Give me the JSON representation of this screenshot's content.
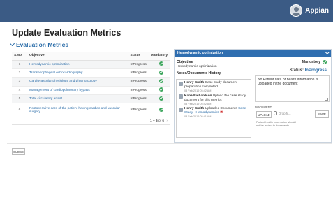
{
  "app": {
    "brand_name": "Appian"
  },
  "page": {
    "title": "Update Evaluation Metrics"
  },
  "section": {
    "title": "Evaluation Metrics"
  },
  "table": {
    "columns": [
      "S.No",
      "Objective",
      "Status",
      "Mandatory"
    ],
    "rows": [
      {
        "sno": "1",
        "objective": "Hemodynamic optimization",
        "status": "InProgress"
      },
      {
        "sno": "2",
        "objective": "Transesophageal echocardiography",
        "status": "InProgress"
      },
      {
        "sno": "3",
        "objective": "Cardiovascular physiology and pharmacology",
        "status": "InProgress"
      },
      {
        "sno": "4",
        "objective": "Management of cardiopulmonary bypass",
        "status": "InProgress"
      },
      {
        "sno": "5",
        "objective": "Total circulatory arrest",
        "status": "InProgress"
      },
      {
        "sno": "6",
        "objective": "Postoperative care of the patient having cardiac and vascular surgery",
        "status": "InProgress"
      }
    ],
    "pager_range": "1 – 6",
    "pager_total": "of 6"
  },
  "detail": {
    "header": "Hemodynamic optimization",
    "objective_label": "Objective",
    "objective_value": "Hemodynamic optimization",
    "mandatory_label": "Mandatory",
    "status_label": "Status:",
    "status_value": "InProgress",
    "notes_label": "Notes/Documents History",
    "notes": [
      {
        "author": "Henry Smith",
        "text": "Case study document preparation completed",
        "time": "08 Feb 2019 05:42 AM"
      },
      {
        "author": "Kane Richardson",
        "text": "Upload the case study document for this metrics",
        "time": "08 Feb 2019 05:42 AM"
      },
      {
        "author": "Henry Smith",
        "text": "Uploaded Documents",
        "link": "Case Study - Hemodynamics",
        "time": "08 Feb 2019 05:41 AM"
      }
    ],
    "comment_text": "No Patient data or health information is uploaded in the document",
    "upload_label": "DOCUMENT",
    "upload_button": "UPLOAD",
    "drop_text": "Drop fil...",
    "save_button": "SAVE",
    "hint": "Patient health information should not be added to documents"
  },
  "footer": {
    "close_button": "CLOSE"
  }
}
